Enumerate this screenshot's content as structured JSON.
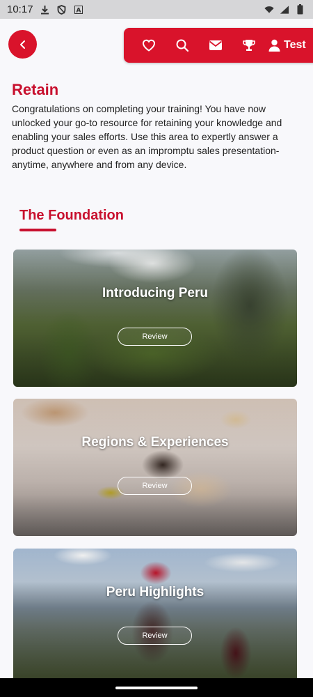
{
  "status_bar": {
    "time": "10:17",
    "left_icons": [
      "download-icon",
      "shield-icon",
      "font-icon"
    ],
    "right_icons": [
      "wifi-icon",
      "cellular-icon",
      "battery-icon"
    ]
  },
  "header": {
    "back_icon": "chevron-left-icon",
    "nav_icons": [
      "heart-icon",
      "search-icon",
      "mail-icon",
      "trophy-icon"
    ],
    "profile_icon": "user-icon",
    "profile_label": "Test",
    "accent_color": "#d9132b"
  },
  "intro": {
    "title": "Retain",
    "description": "Congratulations on completing your training! You have now unlocked your go-to resource for retaining your knowledge and enabling your sales efforts. Use this area to expertly answer a product question or even as an impromptu sales presentation- anytime, anywhere and from any device."
  },
  "section": {
    "heading": "The Foundation"
  },
  "cards": [
    {
      "title": "Introducing Peru",
      "button": "Review"
    },
    {
      "title": "Regions & Experiences",
      "button": "Review"
    },
    {
      "title": "Peru Highlights",
      "button": "Review"
    }
  ]
}
